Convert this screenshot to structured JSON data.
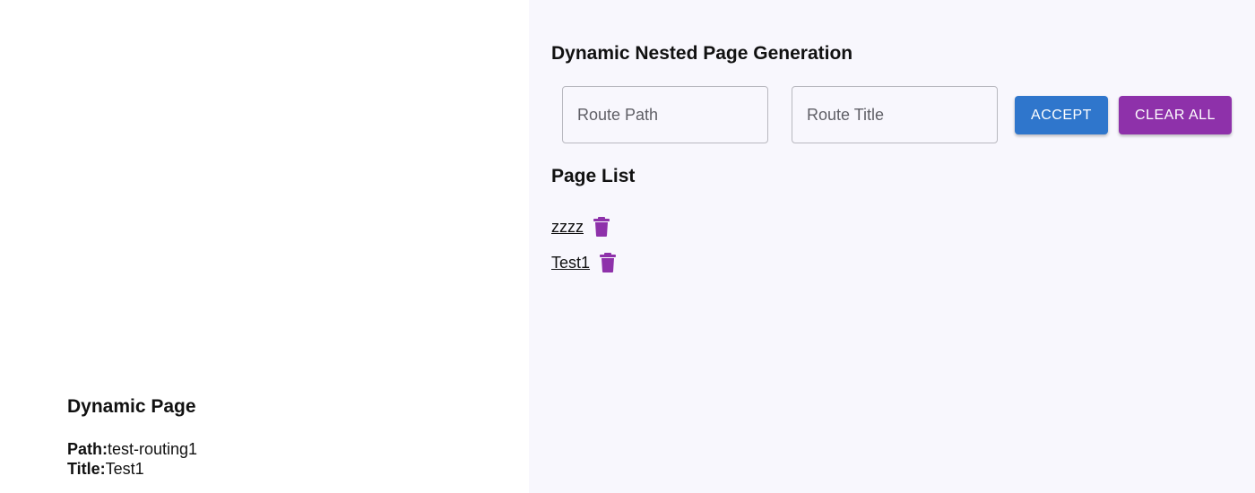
{
  "detail": {
    "heading": "Dynamic Page",
    "path_label": "Path:",
    "path_value": "test-routing1",
    "title_label": "Title:",
    "title_value": "Test1"
  },
  "generator": {
    "heading": "Dynamic Nested Page Generation",
    "route_path_placeholder": "Route Path",
    "route_title_placeholder": "Route Title",
    "accept_label": "ACCEPT",
    "clear_label": "CLEAR ALL"
  },
  "page_list": {
    "heading": "Page List",
    "items": [
      {
        "label": "zzzz",
        "icon": "trash-icon"
      },
      {
        "label": "Test1",
        "icon": "trash-icon"
      }
    ]
  },
  "colors": {
    "accept": "#2f76cc",
    "clear": "#8e31aa",
    "trash": "#8e31aa",
    "right_pane_bg": "#f8f7fd"
  }
}
